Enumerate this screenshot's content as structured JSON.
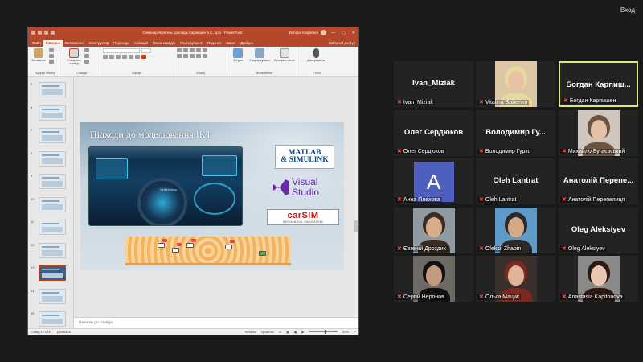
{
  "top": {
    "exit_label": "Вход"
  },
  "ppt": {
    "doc_title": "Семинар Жовтень доповідь Карпишин Б.С..pptx  -  PowerPoint",
    "user_name": "Bohdan Karpishen",
    "window_controls": [
      "—",
      "▢",
      "✕"
    ],
    "tabs": [
      "Файл",
      "Основне",
      "Вставлення",
      "Конструктор",
      "Переходи",
      "Анімація",
      "Показ слайдів",
      "Рецензування",
      "Подання",
      "Запис",
      "Довідка"
    ],
    "active_tab": "Основне",
    "share_label": "Спільний доступ",
    "ribbon": {
      "paste": "Вставити",
      "new_slide": "Створити слайд",
      "shapes": "Фігури",
      "arrange": "Упорядкувати",
      "quick_styles": "Експрес-стилі",
      "dictate": "Диктування",
      "groups": {
        "clipboard": "Буфер обміну",
        "slides": "Слайди",
        "font": "Шрифт",
        "paragraph": "Абзац",
        "drawing": "Малювання",
        "voice": "Голос"
      }
    },
    "thumbs": [
      {
        "num": "5"
      },
      {
        "num": "6"
      },
      {
        "num": "7"
      },
      {
        "num": "8"
      },
      {
        "num": "9"
      },
      {
        "num": "10"
      },
      {
        "num": "11"
      },
      {
        "num": "12"
      },
      {
        "num": "13",
        "selected": true
      },
      {
        "num": "14"
      },
      {
        "num": "15"
      }
    ],
    "slide": {
      "title": "Підходи до моделювання ІКТ",
      "dash_label": "Self-Driving",
      "matlab": [
        "MATLAB",
        "& SIMULINK"
      ],
      "visual_studio": [
        "Visual",
        "Studio"
      ],
      "carsim_main": "carSIM",
      "carsim_sub": "MECHANICAL SIMULATION"
    },
    "notes_placeholder": "Нотатки до слайда",
    "status": {
      "slide_of": "Слайд 13 з 18",
      "language": "російська",
      "notes_btn": "Нотатки",
      "comments_btn": "Примітки",
      "zoom": "83%"
    }
  },
  "participants": [
    {
      "display": "Ivan_Miziak",
      "label": "Ivan_Miziak",
      "type": "name"
    },
    {
      "display": "",
      "label": "Vitalina Babenko",
      "type": "video",
      "bg": "#dbc7a6",
      "face": "#e7c3a4",
      "hair": "#e7d9a0"
    },
    {
      "display": "Богдан  Карпиш...",
      "label": "Богдан Карпишен",
      "type": "name",
      "active": true
    },
    {
      "display": "Олег Сердюков",
      "label": "Олег Сердюков",
      "type": "name"
    },
    {
      "display": "Володимир  Гу...",
      "label": "Володимир Гурко",
      "type": "name"
    },
    {
      "display": "",
      "label": "Михайло Бугаєвський",
      "type": "video",
      "bg": "#cfc7bd",
      "face": "#e4c2a8",
      "hair": "#6b5540"
    },
    {
      "display": "A",
      "label": "Анна Плехова",
      "type": "avatar"
    },
    {
      "display": "Oleh Lantrat",
      "label": "Oleh Lantrat",
      "type": "name"
    },
    {
      "display": "Анатолій  Перепе...",
      "label": "Анатолій Перепелиця",
      "type": "name"
    },
    {
      "display": "",
      "label": "Євгеній Дроздик",
      "type": "video",
      "bg": "#8f9aa3",
      "face": "#d9ad8a",
      "hair": "#3a2c22"
    },
    {
      "display": "",
      "label": "Oleksii Zhabin",
      "type": "video",
      "bg": "#5e9bc9",
      "face": "#d7a888",
      "hair": "#2c2a28"
    },
    {
      "display": "Oleg Aleksiyev",
      "label": "Oleg Aleksiyev",
      "type": "name"
    },
    {
      "display": "",
      "label": "Сергій Неронов",
      "type": "video",
      "bg": "#6d6a66",
      "face": "#c49a7c",
      "hair": "#111111"
    },
    {
      "display": "",
      "label": "Ольга Мацик",
      "type": "video",
      "bg": "#3a2f2a",
      "face": "#dfb49b",
      "hair": "#7a2a20"
    },
    {
      "display": "",
      "label": "Anastasia Kapitonova",
      "type": "video",
      "bg": "#8a8a8a",
      "face": "#e8c6b0",
      "hair": "#2a1a14"
    }
  ]
}
